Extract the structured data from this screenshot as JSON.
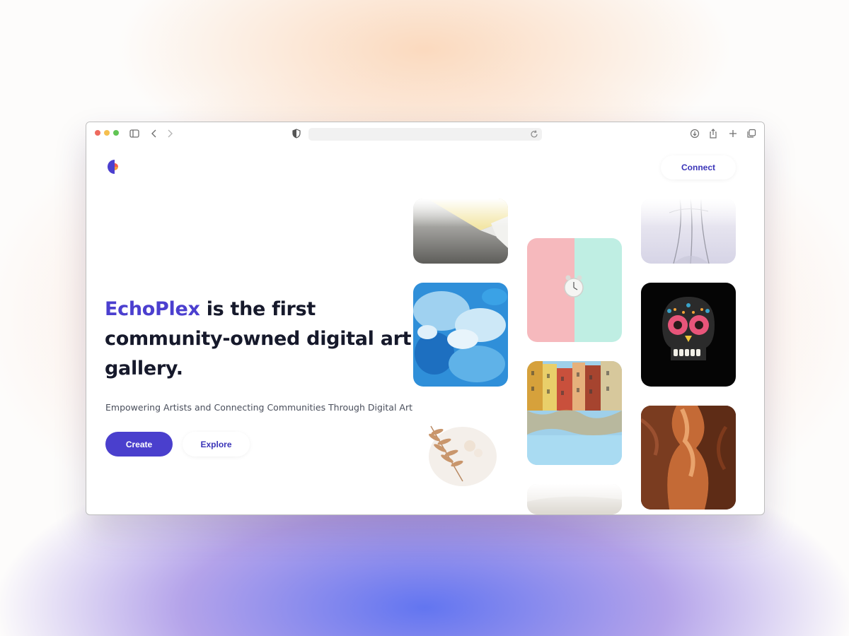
{
  "browser": {
    "url": "",
    "icons": [
      "sidebar-icon",
      "back-icon",
      "forward-icon",
      "shield-icon",
      "reload-icon",
      "download-icon",
      "share-icon",
      "new-tab-icon",
      "tabs-overview-icon"
    ]
  },
  "nav": {
    "connect_label": "Connect"
  },
  "hero": {
    "brand": "EchoPlex",
    "title_rest": " is the first community-owned digital art gallery.",
    "subtitle": "Empowering Artists and Connecting Communities Through Digital Art",
    "create_label": "Create",
    "explore_label": "Explore"
  },
  "gallery": {
    "artworks": [
      "abstract-grey-yellow",
      "pastel-alarm-clock",
      "translucent-vase",
      "blue-texture",
      "calavera-skull",
      "canal-reflection",
      "pressed-fern",
      "antelope-canyon",
      "white-sand"
    ]
  },
  "colors": {
    "brand": "#4b3fcf",
    "text": "#16192b",
    "muted": "#4a4f5c"
  }
}
